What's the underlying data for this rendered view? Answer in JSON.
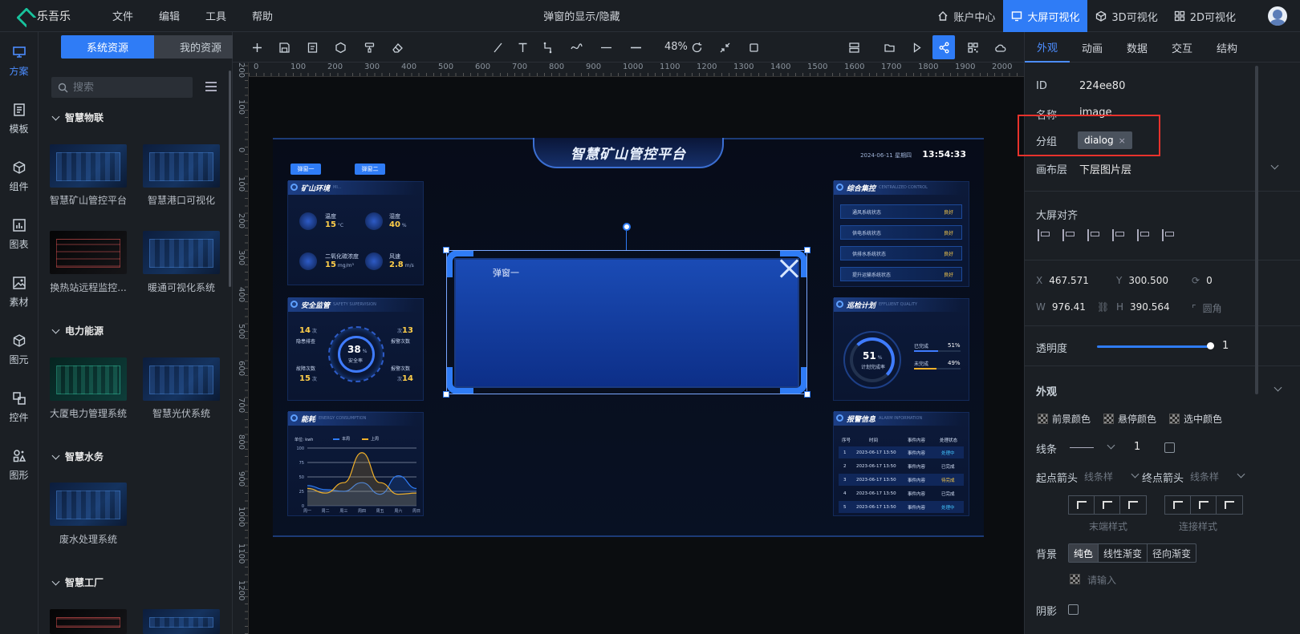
{
  "app": {
    "name": "乐吾乐",
    "document_title": "弹窗的显示/隐藏"
  },
  "menus": [
    "文件",
    "编辑",
    "工具",
    "帮助"
  ],
  "nav": [
    {
      "label": "账户中心",
      "icon": "home-icon",
      "active": false
    },
    {
      "label": "大屏可视化",
      "icon": "monitor-icon",
      "active": true
    },
    {
      "label": "3D可视化",
      "icon": "cube-icon",
      "active": false
    },
    {
      "label": "2D可视化",
      "icon": "grid-icon",
      "active": false
    }
  ],
  "rail": [
    {
      "label": "方案",
      "icon": "monitor-icon",
      "active": true
    },
    {
      "label": "模板",
      "icon": "template-icon",
      "active": false
    },
    {
      "label": "组件",
      "icon": "component-icon",
      "active": false
    },
    {
      "label": "图表",
      "icon": "chart-icon",
      "active": false
    },
    {
      "label": "素材",
      "icon": "image-icon",
      "active": false
    },
    {
      "label": "图元",
      "icon": "cube-icon",
      "active": false
    },
    {
      "label": "控件",
      "icon": "control-icon",
      "active": false
    },
    {
      "label": "图形",
      "icon": "shape-icon",
      "active": false
    }
  ],
  "resources": {
    "tabs": [
      "系统资源",
      "我的资源"
    ],
    "search_placeholder": "搜索",
    "categories": [
      {
        "name": "智慧物联",
        "items": [
          "智慧矿山管控平台",
          "智慧港口可视化",
          "换热站远程监控...",
          "暖通可视化系统"
        ]
      },
      {
        "name": "电力能源",
        "items": [
          "大厦电力管理系统",
          "智慧光伏系统"
        ]
      },
      {
        "name": "智慧水务",
        "items": [
          "废水处理系统"
        ]
      },
      {
        "name": "智慧工厂",
        "items": []
      }
    ]
  },
  "toolbar": {
    "zoom": "48%"
  },
  "ruler": {
    "h": [
      "0",
      "100",
      "200",
      "300",
      "400",
      "500",
      "600",
      "700",
      "800",
      "900",
      "1000",
      "1100",
      "1200",
      "1300",
      "1400",
      "1500",
      "1600",
      "1700",
      "1800",
      "1900",
      "2000"
    ],
    "v": [
      "200",
      "100",
      "0",
      "100",
      "200",
      "300",
      "400",
      "500",
      "600",
      "700",
      "800",
      "900",
      "1000",
      "1100",
      "1200"
    ]
  },
  "dashboard": {
    "title": "智慧矿山管控平台",
    "date": "2024-06-11",
    "weekday": "星期四",
    "time": "13:54:33",
    "buttons": [
      "弹窗一",
      "弹窗二"
    ],
    "panels": {
      "env": {
        "title": "矿山环境",
        "sub": "MI...",
        "items": [
          {
            "label": "温度",
            "value": "15",
            "unit": "°C"
          },
          {
            "label": "湿度",
            "value": "40",
            "unit": "%"
          },
          {
            "label": "二氧化碳浓度",
            "value": "15",
            "unit": "mg/m³"
          },
          {
            "label": "风速",
            "value": "2.8",
            "unit": "m/s"
          }
        ]
      },
      "safety": {
        "title": "安全监管",
        "sub": "SAFETY SUPERVISION",
        "center_value": "38",
        "center_unit": "%",
        "center_label": "安全率",
        "items": [
          {
            "label": "隐患排查",
            "value": "14",
            "unit": "次"
          },
          {
            "label": "报警次数",
            "value": "13",
            "unit": "次"
          },
          {
            "label": "故障次数",
            "value": "15",
            "unit": "次"
          },
          {
            "label": "报警次数",
            "value": "14",
            "unit": "次"
          }
        ]
      },
      "energy": {
        "title": "能耗",
        "sub": "ENERGY CONSUMPTION",
        "unit_label": "单位: kwh",
        "legend": [
          "本周",
          "上周"
        ]
      },
      "control": {
        "title": "综合集控",
        "sub": "CENTRALIZED CONTROL",
        "rows": [
          {
            "label": "通风系统状态",
            "status": "良好"
          },
          {
            "label": "供电系统状态",
            "status": "良好"
          },
          {
            "label": "供排水系统状态",
            "status": "良好"
          },
          {
            "label": "提升运输系统状态",
            "status": "良好"
          }
        ]
      },
      "inspection": {
        "title": "巡检计划",
        "sub": "EFFLUENT QUALITY",
        "center_value": "51",
        "center_unit": "%",
        "center_label": "计划完成率",
        "items": [
          {
            "label": "已完成",
            "value": "51",
            "unit": "%"
          },
          {
            "label": "未完成",
            "value": "49",
            "unit": "%"
          }
        ]
      },
      "alarm": {
        "title": "报警信息",
        "sub": "ALARM INFORMATION",
        "headers": [
          "序号",
          "时间",
          "事件内容",
          "处理状态"
        ],
        "rows": [
          {
            "no": "1",
            "time": "2023-06-17 13:50",
            "event": "事件内容",
            "status": "处理中"
          },
          {
            "no": "2",
            "time": "2023-06-17 13:50",
            "event": "事件内容",
            "status": "已完成"
          },
          {
            "no": "3",
            "time": "2023-06-17 13:50",
            "event": "事件内容",
            "status": "待完成"
          },
          {
            "no": "4",
            "time": "2023-06-17 13:50",
            "event": "事件内容",
            "status": "已完成"
          },
          {
            "no": "5",
            "time": "2023-06-17 13:50",
            "event": "事件内容",
            "status": "处理中"
          }
        ]
      }
    },
    "chart_data": {
      "type": "line",
      "categories": [
        "周一",
        "周二",
        "周三",
        "周四",
        "周五",
        "周六",
        "周日"
      ],
      "ylim": [
        0,
        100
      ],
      "yticks": [
        "100",
        "75",
        "50",
        "25",
        "0"
      ],
      "series": [
        {
          "name": "本周",
          "color": "#2f7cf6",
          "values": [
            35,
            28,
            25,
            40,
            20,
            52,
            30
          ]
        },
        {
          "name": "上周",
          "color": "#f0b02a",
          "values": [
            30,
            22,
            40,
            92,
            40,
            20,
            22
          ]
        }
      ]
    }
  },
  "dialog": {
    "title": "弹窗一"
  },
  "props": {
    "tabs": [
      "外观",
      "动画",
      "数据",
      "交互",
      "结构"
    ],
    "id_label": "ID",
    "id": "224ee80",
    "name_label": "名称",
    "name": "image",
    "group_label": "分组",
    "group_tag": "dialog",
    "layer_label": "画布层",
    "layer": "下层图片层",
    "align_label": "大屏对齐",
    "x_label": "X",
    "x": "467.571",
    "y_label": "Y",
    "y": "300.500",
    "rot": "0",
    "w_label": "W",
    "w": "976.41",
    "h_label": "H",
    "h": "390.564",
    "radius_label": "圆角",
    "opacity_label": "透明度",
    "opacity": "1",
    "section_appearance": "外观",
    "colors": [
      "前景颜色",
      "悬停颜色",
      "选中颜色"
    ],
    "line_label": "线条",
    "line_width": "1",
    "start_arrow_label": "起点箭头",
    "end_arrow_label": "终点箭头",
    "arrow_value": "线条样",
    "end_style_label": "末端样式",
    "join_style_label": "连接样式",
    "bg_label": "背景",
    "bg_options": [
      "纯色",
      "线性渐变",
      "径向渐变"
    ],
    "bg_placeholder": "请输入",
    "shadow_label": "阴影"
  }
}
